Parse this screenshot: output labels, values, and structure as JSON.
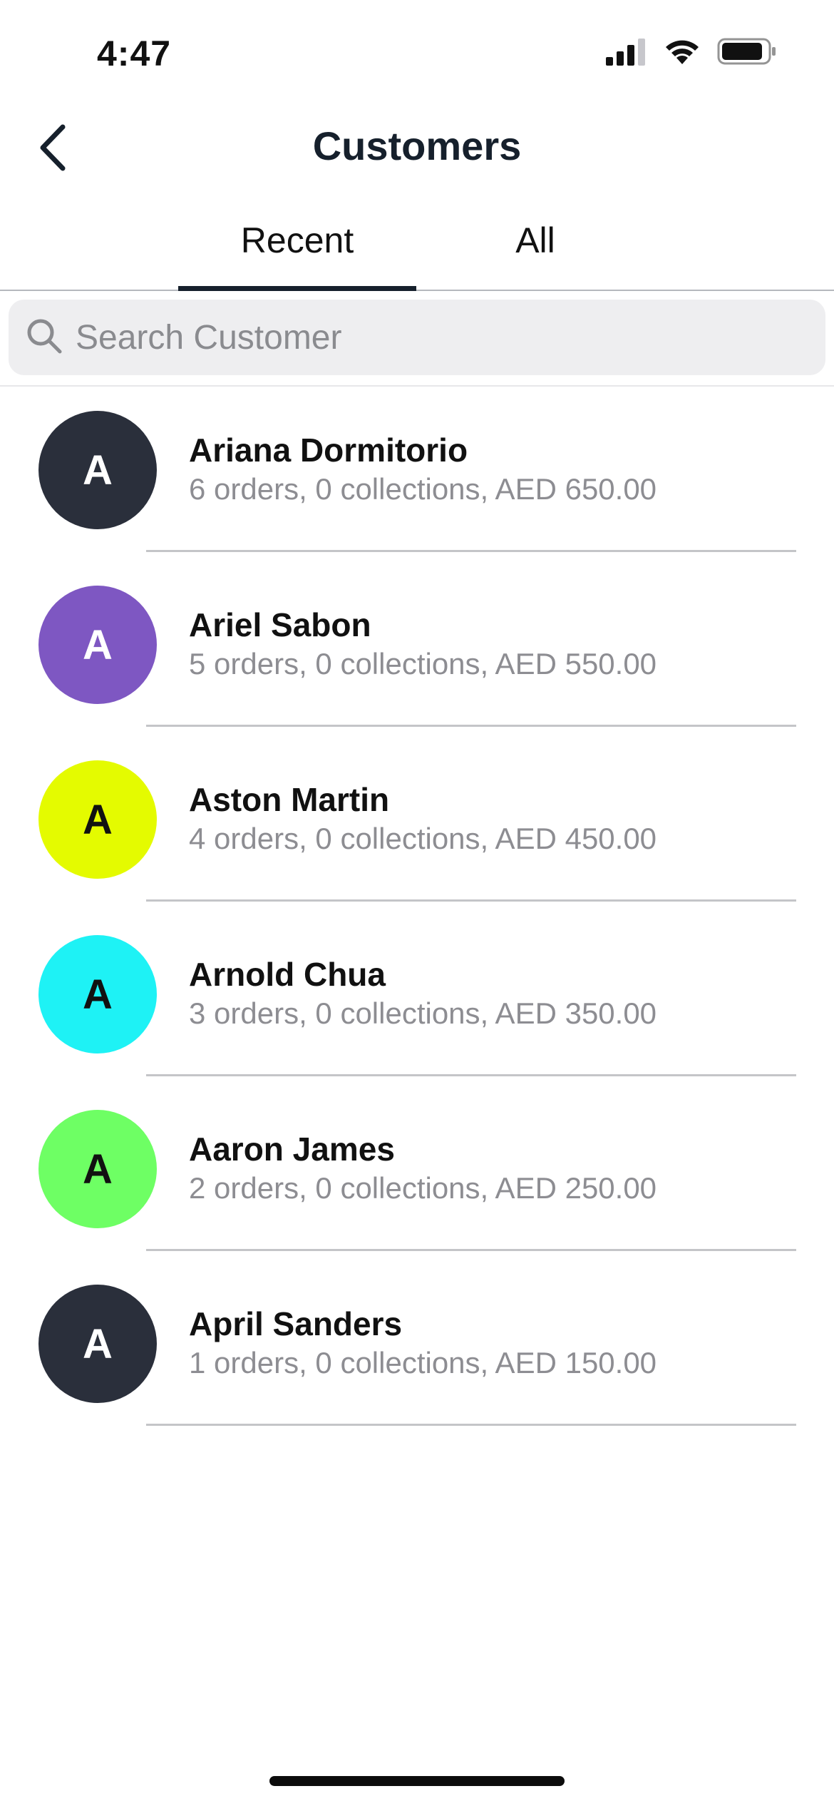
{
  "status_bar": {
    "time": "4:47"
  },
  "header": {
    "title": "Customers"
  },
  "tabs": [
    {
      "label": "Recent",
      "selected": true
    },
    {
      "label": "All",
      "selected": false
    }
  ],
  "search": {
    "placeholder": "Search Customer",
    "value": ""
  },
  "customers": [
    {
      "initial": "A",
      "name": "Ariana Dormitorio",
      "summary": "6 orders, 0 collections, AED 650.00",
      "avatar_color": "#2a2f3b",
      "text_color": "#ffffff"
    },
    {
      "initial": "A",
      "name": "Ariel Sabon",
      "summary": "5 orders, 0 collections, AED 550.00",
      "avatar_color": "#7e57c2",
      "text_color": "#ffffff"
    },
    {
      "initial": "A",
      "name": "Aston Martin",
      "summary": "4 orders, 0 collections, AED 450.00",
      "avatar_color": "#e4fb00",
      "text_color": "#111111"
    },
    {
      "initial": "A",
      "name": "Arnold Chua",
      "summary": "3 orders, 0 collections, AED 350.00",
      "avatar_color": "#1ef2f5",
      "text_color": "#111111"
    },
    {
      "initial": "A",
      "name": "Aaron James",
      "summary": "2 orders, 0 collections, AED 250.00",
      "avatar_color": "#6eff64",
      "text_color": "#111111"
    },
    {
      "initial": "A",
      "name": "April Sanders",
      "summary": "1 orders, 0 collections, AED 150.00",
      "avatar_color": "#2a2f3b",
      "text_color": "#ffffff"
    }
  ]
}
